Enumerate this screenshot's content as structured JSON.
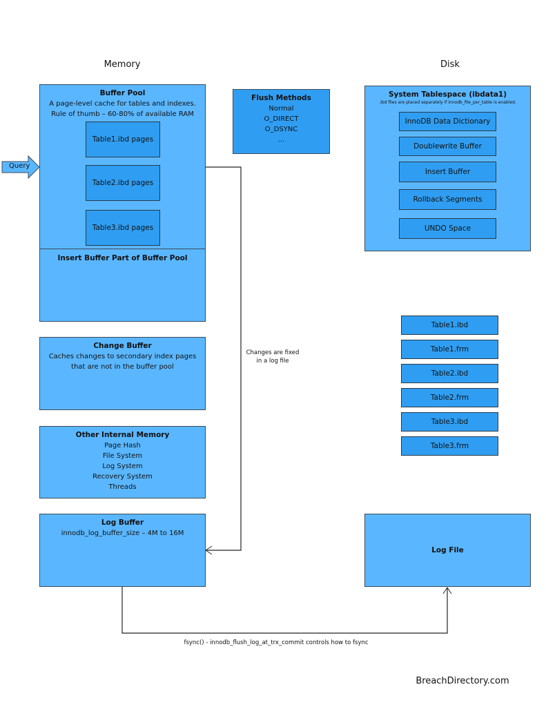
{
  "sections": {
    "memory": "Memory",
    "disk": "Disk"
  },
  "query": {
    "label": "Query"
  },
  "buffer_pool": {
    "title": "Buffer Pool",
    "lines": [
      "A page-level cache for tables and indexes.",
      "Rule of thumb – 60-80% of available RAM"
    ],
    "pages": [
      "Table1.ibd pages",
      "Table2.ibd pages",
      "Table3.ibd pages"
    ],
    "insert_buffer_title": "Insert Buffer Part of Buffer Pool"
  },
  "flush_methods": {
    "title": "Flush Methods",
    "items": [
      "Normal",
      "O_DIRECT",
      "O_DSYNC",
      "..."
    ]
  },
  "system_tablespace": {
    "title": "System Tablespace (ibdata1)",
    "note": ".ibd files are placed separately if innodb_file_per_table is enabled.",
    "items": [
      "InnoDB Data Dictionary",
      "Doublewrite Buffer",
      "Insert Buffer",
      "Rollback Segments",
      "UNDO Space"
    ]
  },
  "change_buffer": {
    "title": "Change Buffer",
    "lines": [
      "Caches changes to secondary index pages",
      "that are not in the buffer pool"
    ]
  },
  "other_memory": {
    "title": "Other Internal Memory",
    "items": [
      "Page Hash",
      "File System",
      "Log System",
      "Recovery System",
      "Threads"
    ]
  },
  "log_buffer": {
    "title": "Log Buffer",
    "line": "innodb_log_buffer_size – 4M to 16M"
  },
  "log_file": {
    "title": "Log File"
  },
  "disk_files": [
    "Table1.ibd",
    "Table1.frm",
    "Table2.ibd",
    "Table2.frm",
    "Table3.ibd",
    "Table3.frm"
  ],
  "connector_labels": {
    "changes": [
      "Changes are fixed",
      "in a log file"
    ],
    "fsync": "fsync() - innodb_flush_log_at_trx_commit controls how to fsync"
  },
  "watermark": "BreachDirectory.com",
  "colors": {
    "box": "#5ab7ff",
    "inner": "#2f9ef2",
    "border": "#3c4a5a"
  }
}
